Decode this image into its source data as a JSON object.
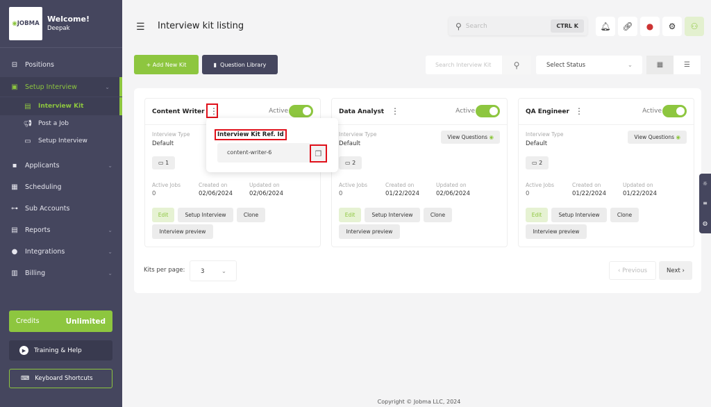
{
  "sidebar": {
    "logo": "JOBMA",
    "welcome": "Welcome!",
    "user": "Deepak",
    "items": [
      {
        "label": "Positions",
        "icon": "briefcase-icon"
      },
      {
        "label": "Setup Interview",
        "icon": "presentation-icon"
      },
      {
        "label": "Interview Kit"
      },
      {
        "label": "Post a Job"
      },
      {
        "label": "Setup Interview"
      },
      {
        "label": "Applicants"
      },
      {
        "label": "Scheduling"
      },
      {
        "label": "Sub Accounts"
      },
      {
        "label": "Reports"
      },
      {
        "label": "Integrations"
      },
      {
        "label": "Billing"
      }
    ],
    "credits_label": "Credits",
    "credits_value": "Unlimited",
    "training": "Training & Help",
    "shortcuts": "Keyboard Shortcuts"
  },
  "header": {
    "title": "Interview kit listing",
    "search_placeholder": "Search",
    "shortcut": "CTRL K"
  },
  "toolbar": {
    "add": "+ Add New Kit",
    "library": "Question Library",
    "search_placeholder": "Search Interview Kit",
    "status": "Select Status"
  },
  "cards": [
    {
      "name": "Content Writer",
      "status": "Active",
      "type_label": "Interview Type",
      "type": "Default",
      "count": "1",
      "jobs_label": "Active Jobs",
      "jobs": "0",
      "created_label": "Created on",
      "created": "02/06/2024",
      "updated_label": "Updated on",
      "updated": "02/06/2024"
    },
    {
      "name": "Data Analyst",
      "status": "Active",
      "type_label": "Interview Type",
      "type": "Default",
      "count": "2",
      "jobs_label": "Active Jobs",
      "jobs": "0",
      "created_label": "Created on",
      "created": "01/22/2024",
      "updated_label": "Updated on",
      "updated": "02/06/2024"
    },
    {
      "name": "QA Engineer",
      "status": "Active",
      "type_label": "Interview Type",
      "type": "Default",
      "count": "2",
      "jobs_label": "Active Jobs",
      "jobs": "0",
      "created_label": "Created on",
      "created": "01/22/2024",
      "updated_label": "Updated on",
      "updated": "01/22/2024"
    }
  ],
  "card_actions": {
    "view": "View Questions",
    "edit": "Edit",
    "setup": "Setup Interview",
    "clone": "Clone",
    "preview": "Interview preview"
  },
  "popover": {
    "title": "Interview Kit Ref. Id",
    "ref_id": "content-writer-6"
  },
  "pagination": {
    "label": "Kits per page:",
    "per_page": "3",
    "prev": "‹ Previous",
    "next": "Next ›"
  },
  "footer": "Copyright © Jobma LLC, 2024",
  "colors": {
    "accent": "#8dc63f",
    "sidebar": "#45465e",
    "highlight": "#e0101a"
  }
}
